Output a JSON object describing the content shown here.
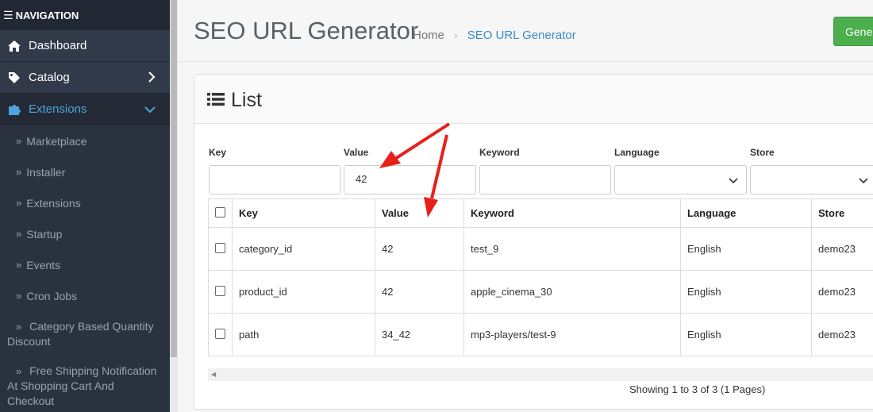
{
  "sidebar": {
    "header": "NAVIGATION",
    "items": [
      {
        "label": "Dashboard",
        "icon": "home-icon"
      },
      {
        "label": "Catalog",
        "icon": "tag-icon"
      },
      {
        "label": "Extensions",
        "icon": "puzzle-icon"
      }
    ],
    "subitems": [
      "Marketplace",
      "Installer",
      "Extensions",
      "Startup",
      "Events",
      "Cron Jobs"
    ],
    "multi": [
      {
        "line1": "Category Based Quantity",
        "line2": "Discount"
      },
      {
        "line1": "Free Shipping Notification",
        "line2": "At Shopping Cart And Checkout"
      }
    ]
  },
  "header": {
    "title": "SEO URL Generator",
    "breadcrumb": {
      "home": "Home",
      "separator": "›",
      "current": "SEO URL Generator"
    },
    "generate_button": "Gener"
  },
  "card": {
    "title": "List"
  },
  "filters": {
    "key_label": "Key",
    "key_value": "",
    "value_label": "Value",
    "value_value": "42",
    "keyword_label": "Keyword",
    "keyword_value": "",
    "language_label": "Language",
    "language_value": "",
    "store_label": "Store",
    "store_value": ""
  },
  "table": {
    "columns": [
      "Key",
      "Value",
      "Keyword",
      "Language",
      "Store"
    ],
    "rows": [
      [
        "category_id",
        "42",
        "test_9",
        "English",
        "demo23"
      ],
      [
        "product_id",
        "42",
        "apple_cinema_30",
        "English",
        "demo23"
      ],
      [
        "path",
        "34_42",
        "mp3-players/test-9",
        "English",
        "demo23"
      ]
    ]
  },
  "pagination": {
    "showing": "Showing 1 to 3 of 3 (1 Pages)"
  },
  "colors": {
    "sidebar": "#2a3240",
    "accent": "#4fa3dd",
    "button": "#4cae4c",
    "arrow": "#e8201a"
  }
}
